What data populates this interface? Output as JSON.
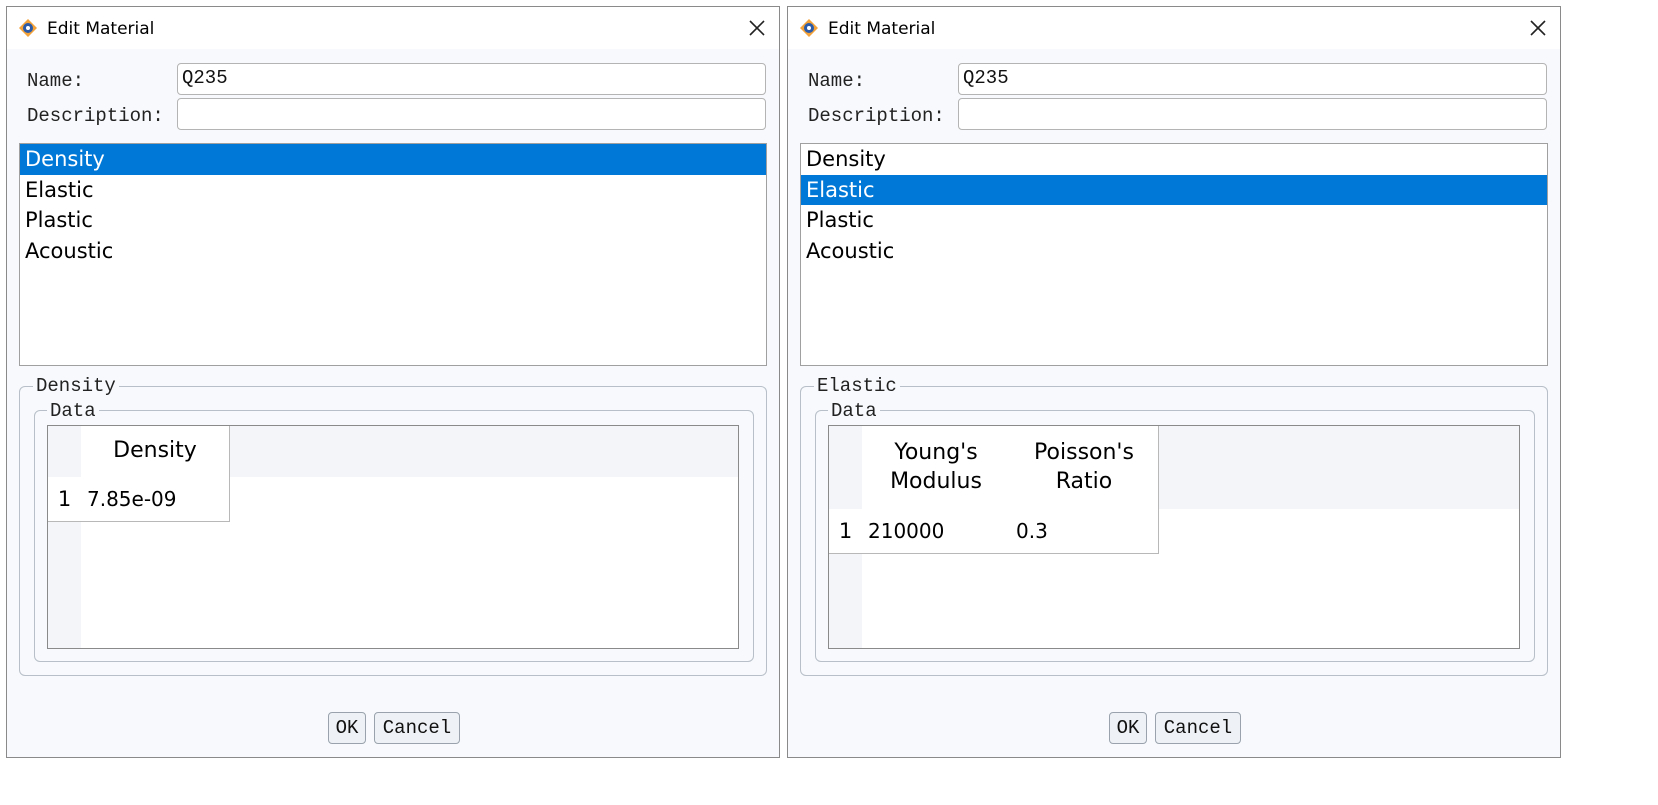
{
  "dialogs": [
    {
      "title": "Edit Material",
      "name_label": "Name:",
      "name_value": "Q235",
      "description_label": "Description:",
      "description_value": "",
      "properties": [
        "Density",
        "Elastic",
        "Plastic",
        "Acoustic"
      ],
      "selected_property": "Density",
      "section_title": "Density",
      "data_group_title": "Data",
      "table": {
        "columns": [
          "Density"
        ],
        "rows": [
          {
            "num": "1",
            "cells": [
              "7.85e-09"
            ]
          }
        ]
      },
      "ok_label": "OK",
      "cancel_label": "Cancel"
    },
    {
      "title": "Edit Material",
      "name_label": "Name:",
      "name_value": "Q235",
      "description_label": "Description:",
      "description_value": "",
      "properties": [
        "Density",
        "Elastic",
        "Plastic",
        "Acoustic"
      ],
      "selected_property": "Elastic",
      "section_title": "Elastic",
      "data_group_title": "Data",
      "table": {
        "columns": [
          "Young's Modulus",
          "Poisson's Ratio"
        ],
        "rows": [
          {
            "num": "1",
            "cells": [
              "210000",
              "0.3"
            ]
          }
        ]
      },
      "ok_label": "OK",
      "cancel_label": "Cancel"
    }
  ],
  "icons": {
    "app": "material-app-icon",
    "close": "close-icon"
  }
}
